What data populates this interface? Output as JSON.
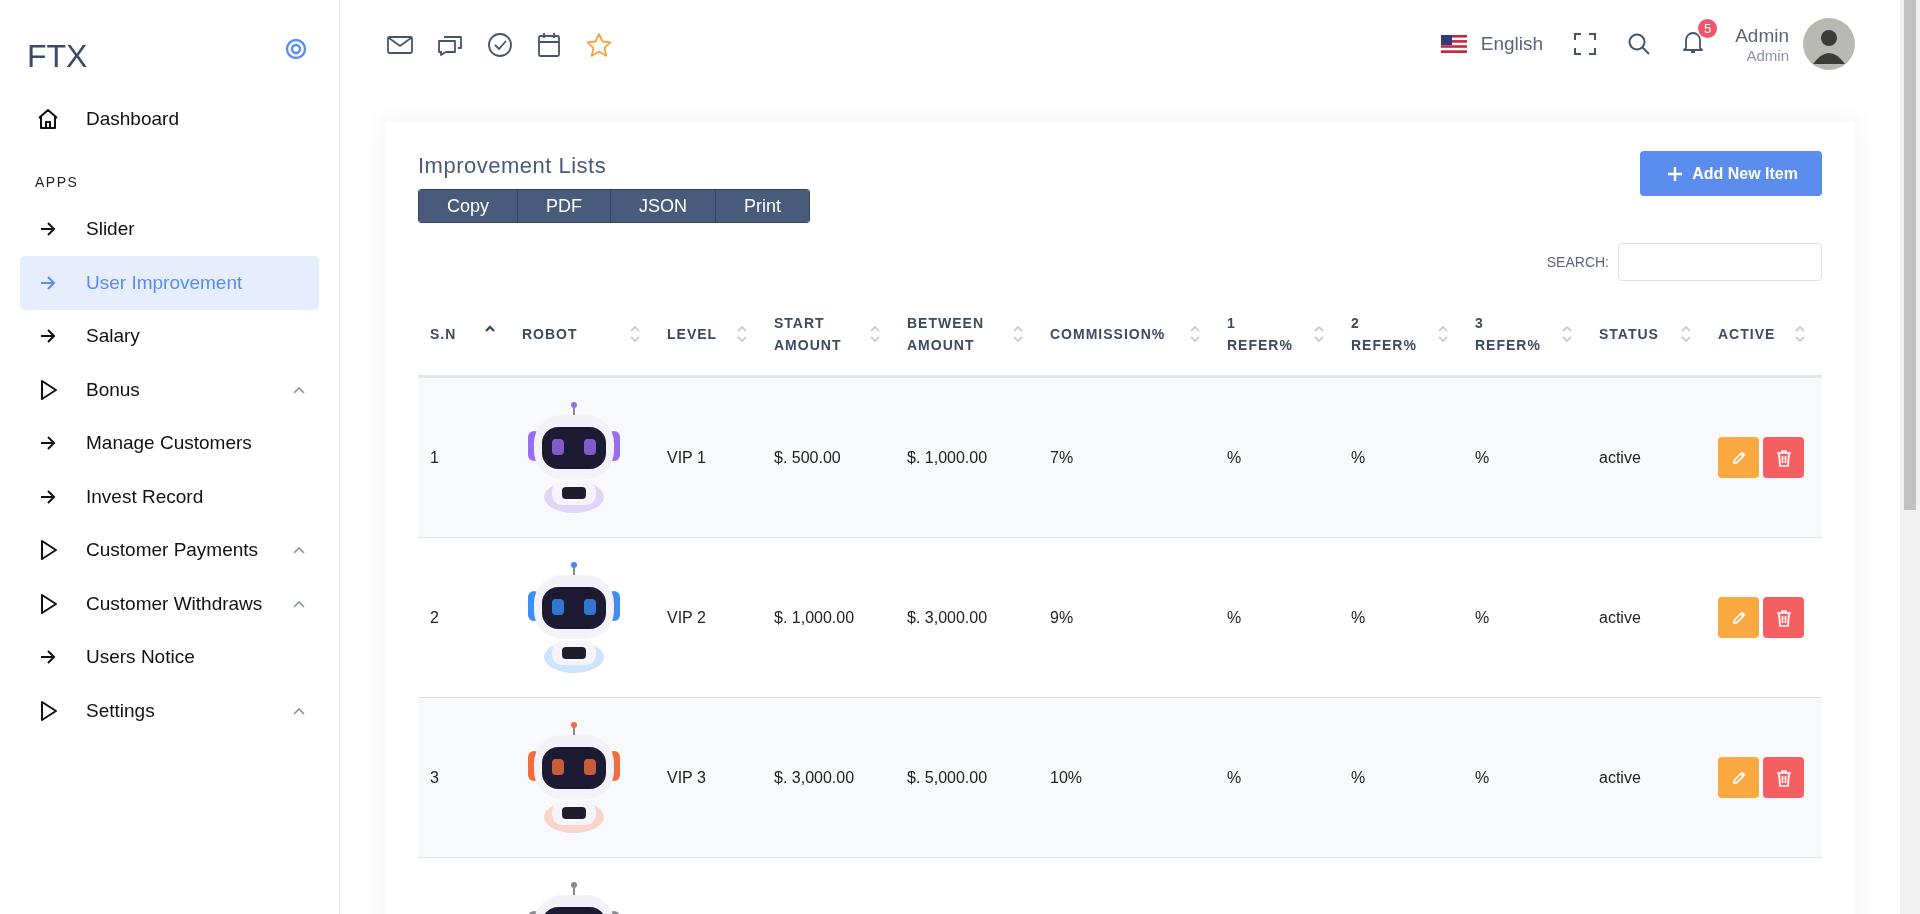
{
  "sidebar": {
    "logo": "FTX",
    "items": [
      {
        "kind": "home",
        "label": "Dashboard",
        "selected": false
      },
      {
        "kind": "section",
        "label": "APPS"
      },
      {
        "kind": "link",
        "label": "Slider",
        "selected": false
      },
      {
        "kind": "link",
        "label": "User Improvement",
        "selected": true
      },
      {
        "kind": "link",
        "label": "Salary",
        "selected": false
      },
      {
        "kind": "group",
        "label": "Bonus",
        "selected": false
      },
      {
        "kind": "link",
        "label": "Manage Customers",
        "selected": false
      },
      {
        "kind": "link",
        "label": "Invest Record",
        "selected": false
      },
      {
        "kind": "group",
        "label": "Customer Payments",
        "selected": false
      },
      {
        "kind": "group",
        "label": "Customer Withdraws",
        "selected": false
      },
      {
        "kind": "link",
        "label": "Users Notice",
        "selected": false
      },
      {
        "kind": "group",
        "label": "Settings",
        "selected": false
      }
    ]
  },
  "topbar": {
    "language": "English",
    "notification_count": "5",
    "user_name": "Admin",
    "user_role": "Admin"
  },
  "card": {
    "title": "Improvement Lists",
    "export_buttons": [
      "Copy",
      "PDF",
      "JSON",
      "Print"
    ],
    "add_button": "Add New Item",
    "search_label": "SEARCH:"
  },
  "table": {
    "columns": [
      {
        "label": "S.N",
        "sorted": true
      },
      {
        "label": "ROBOT",
        "sorted": false
      },
      {
        "label": "LEVEL",
        "sorted": false
      },
      {
        "label": "START AMOUNT",
        "sorted": false
      },
      {
        "label": "BETWEEN AMOUNT",
        "sorted": false
      },
      {
        "label": "COMMISSION%",
        "sorted": false
      },
      {
        "label": "1 REFER%",
        "sorted": false
      },
      {
        "label": "2 REFER%",
        "sorted": false
      },
      {
        "label": "3 REFER%",
        "sorted": false
      },
      {
        "label": "STATUS",
        "sorted": false
      },
      {
        "label": "ACTIVE",
        "sorted": false
      }
    ],
    "rows": [
      {
        "sn": "1",
        "robot": {
          "kind": "picture"
        },
        "level": "VIP 1",
        "start": "$. 500.00",
        "between": "$. 1,000.00",
        "commission": "7%",
        "refer1": "%",
        "refer2": "%",
        "refer3": "%",
        "status": "active"
      },
      {
        "sn": "2",
        "robot": {
          "kind": "picture"
        },
        "level": "VIP 2",
        "start": "$. 1,000.00",
        "between": "$. 3,000.00",
        "commission": "9%",
        "refer1": "%",
        "refer2": "%",
        "refer3": "%",
        "status": "active"
      },
      {
        "sn": "3",
        "robot": {
          "kind": "picture"
        },
        "level": "VIP 3",
        "start": "$. 3,000.00",
        "between": "$. 5,000.00",
        "commission": "10%",
        "refer1": "%",
        "refer2": "%",
        "refer3": "%",
        "status": "active"
      },
      {
        "robot": {
          "kind": "picture"
        }
      }
    ]
  }
}
